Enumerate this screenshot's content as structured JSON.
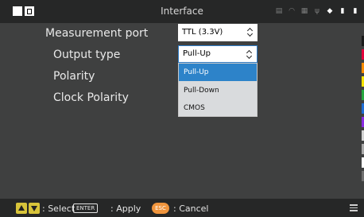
{
  "statusbar": {
    "title": "Interface",
    "icons": [
      "printer-icon",
      "wifi-icon",
      "network-icon",
      "usb-icon",
      "tag-icon",
      "sd-card-icon",
      "battery-icon"
    ]
  },
  "settings": {
    "measurement_port": {
      "label": "Measurement port",
      "value": "TTL (3.3V)"
    },
    "output_type": {
      "label": "Output type",
      "value": "Pull-Up"
    },
    "polarity": {
      "label": "Polarity"
    },
    "clock_polarity": {
      "label": "Clock Polarity"
    }
  },
  "dropdown": {
    "options": [
      "Pull-Up",
      "Pull-Down",
      "CMOS"
    ],
    "selected": "Pull-Up"
  },
  "footer": {
    "select_text": ": Select",
    "enter_key": "ENTER",
    "apply_text": ": Apply",
    "esc_key": "ESC",
    "cancel_text": ": Cancel"
  },
  "colors": {
    "highlight": "#2d83c9",
    "strip": [
      "#1a1a1a",
      "#e4003a",
      "#ff8c00",
      "#f6e300",
      "#26a83f",
      "#1e6dd6",
      "#8a2be2",
      "#d3d3d3",
      "#aaaaaa",
      "#ffffff",
      "#6f6f6f"
    ]
  }
}
